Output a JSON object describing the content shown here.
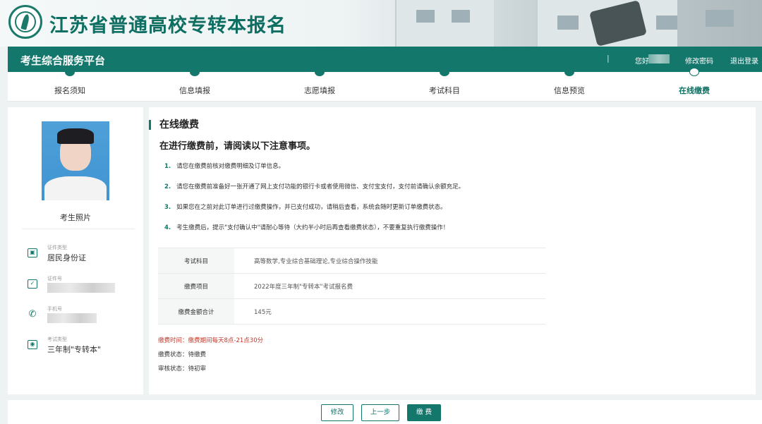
{
  "banner": {
    "site_title": "江苏省普通高校专转本报名"
  },
  "header": {
    "platform": "考生综合服务平台",
    "separator": "|",
    "greeting": "您好",
    "change_password": "修改密码",
    "logout": "退出登录"
  },
  "steps": [
    {
      "label": "报名须知"
    },
    {
      "label": "信息填报"
    },
    {
      "label": "志愿填报"
    },
    {
      "label": "考试科目"
    },
    {
      "label": "信息预览"
    },
    {
      "label": "在线缴费"
    }
  ],
  "profile": {
    "photo_caption": "考生照片",
    "id_type_label": "证件类型",
    "id_type_value": "居民身份证",
    "id_number_label": "证件号",
    "phone_label": "手机号",
    "exam_type_label": "考试类型",
    "exam_type_value": "三年制\"专转本\""
  },
  "main": {
    "title": "在线缴费",
    "subtitle": "在进行缴费前，请阅读以下注意事项。",
    "notices": [
      {
        "num": "1.",
        "text": "请您在缴费前核对缴费明细及订单信息。"
      },
      {
        "num": "2.",
        "text": "请您在缴费前准备好一张开通了网上支付功能的银行卡或者使用微信、支付宝支付，支付前请确认余额充足。"
      },
      {
        "num": "3.",
        "text": "如果您在之前对此订单进行过缴费操作，并已支付成功，请稍后查看，系统会随时更新订单缴费状态。"
      },
      {
        "num": "4.",
        "text": "考生缴费后，提示\"支付确认中\"请耐心等待（大约半小时后再查看缴费状态），不要重复执行缴费操作！"
      }
    ],
    "fee_table": [
      {
        "key": "考试科目",
        "value": "高等数学,专业综合基础理论,专业综合操作技能"
      },
      {
        "key": "缴费项目",
        "value": "2022年度三年制\"专转本\"考试报名费"
      },
      {
        "key": "缴费金额合计",
        "value": "145元"
      }
    ],
    "pay_time": "缴费时间：缴费期间每天8点-21点30分",
    "pay_status": "缴费状态：待缴费",
    "review_status": "审核状态：待初审"
  },
  "buttons": {
    "modify": "修改",
    "prev": "上一步",
    "pay": "缴 费"
  },
  "colors": {
    "accent": "#14776c",
    "warning": "#c0392b"
  }
}
